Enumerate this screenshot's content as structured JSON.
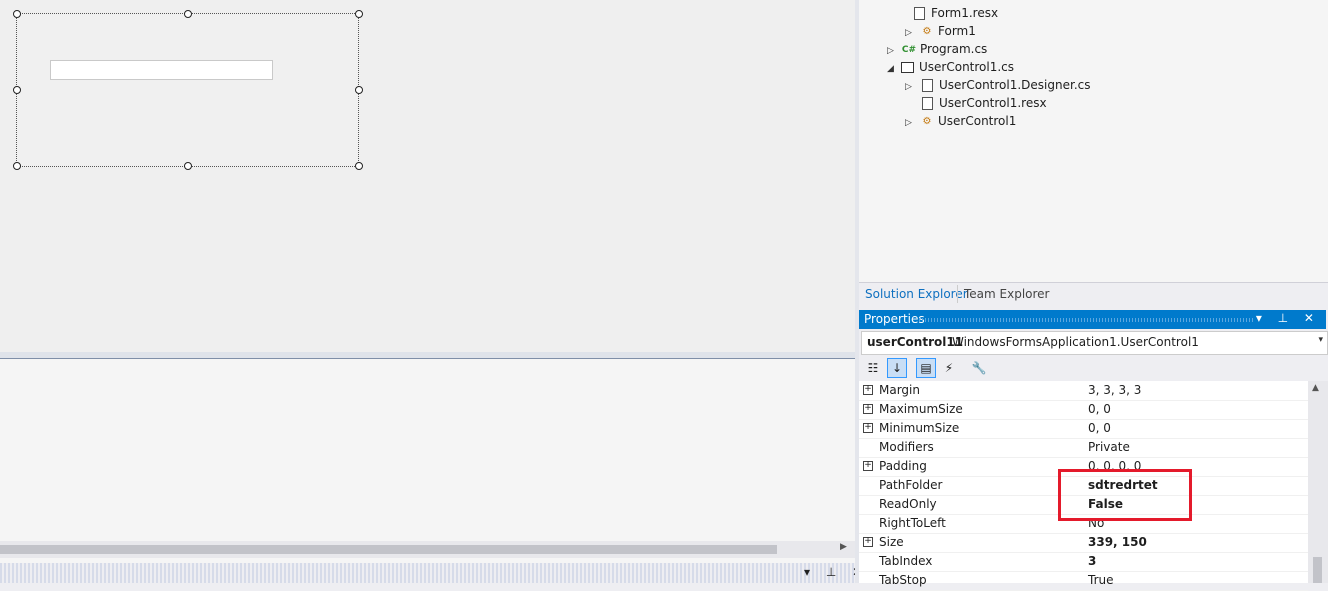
{
  "solution_explorer": {
    "items": [
      {
        "label": "Form1.resx",
        "icon": "resx-file-icon",
        "expander": ""
      },
      {
        "label": "Form1",
        "icon": "class-icon",
        "expander": "▷"
      },
      {
        "label": "Program.cs",
        "icon": "csharp-file-icon",
        "expander": "▷"
      },
      {
        "label": "UserControl1.cs",
        "icon": "user-control-icon",
        "expander": "◢"
      },
      {
        "label": "UserControl1.Designer.cs",
        "icon": "designer-file-icon",
        "expander": "▷"
      },
      {
        "label": "UserControl1.resx",
        "icon": "resx-file-icon",
        "expander": ""
      },
      {
        "label": "UserControl1",
        "icon": "class-icon",
        "expander": "▷"
      }
    ],
    "tabs": {
      "solution_explorer": "Solution Explorer",
      "team_explorer": "Team Explorer"
    }
  },
  "properties": {
    "title": "Properties",
    "title_controls": "▾ ⊥ ✕",
    "object_name": "userControl11",
    "object_type": "WindowsFormsApplication1.UserControl1",
    "toolbar": {
      "categorized": "categorized-icon",
      "alphabetical": "alphabetical-icon",
      "properties": "properties-icon",
      "events": "events-icon",
      "property_pages": "property-pages-icon"
    },
    "rows": [
      {
        "name": "Margin",
        "value": "3, 3, 3, 3",
        "expandable": true,
        "bold": false
      },
      {
        "name": "MaximumSize",
        "value": "0, 0",
        "expandable": true,
        "bold": false
      },
      {
        "name": "MinimumSize",
        "value": "0, 0",
        "expandable": true,
        "bold": false
      },
      {
        "name": "Modifiers",
        "value": "Private",
        "expandable": false,
        "bold": false
      },
      {
        "name": "Padding",
        "value": "0, 0, 0, 0",
        "expandable": true,
        "bold": false
      },
      {
        "name": "PathFolder",
        "value": "sdtredrtet",
        "expandable": false,
        "bold": true
      },
      {
        "name": "ReadOnly",
        "value": "False",
        "expandable": false,
        "bold": true
      },
      {
        "name": "RightToLeft",
        "value": "No",
        "expandable": false,
        "bold": false
      },
      {
        "name": "Size",
        "value": "339, 150",
        "expandable": true,
        "bold": true
      },
      {
        "name": "TabIndex",
        "value": "3",
        "expandable": false,
        "bold": true
      },
      {
        "name": "TabStop",
        "value": "True",
        "expandable": false,
        "bold": false
      }
    ]
  },
  "bottom_panel": {
    "controls": "▾ ⊥ ✕"
  },
  "colors": {
    "accent": "#007acc",
    "highlight": "#e41a2b",
    "link_tab": "#0e70c0"
  }
}
